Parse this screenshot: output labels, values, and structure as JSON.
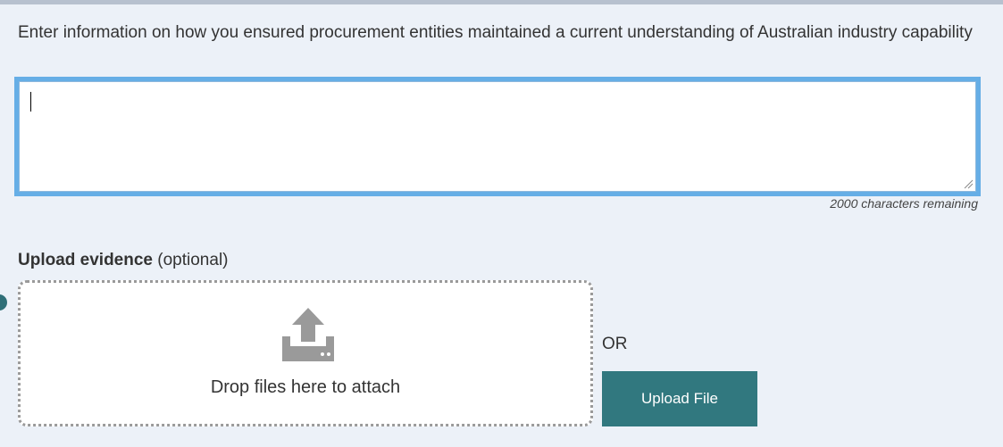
{
  "form": {
    "prompt": "Enter information on how you ensured procurement entities maintained a current understanding of Australian industry capability",
    "textarea_value": "",
    "chars_remaining": "2000 characters remaining"
  },
  "upload": {
    "label_strong": "Upload evidence",
    "label_optional": "(optional)",
    "drop_text": "Drop files here to attach",
    "drop_icon": "upload-tray-icon",
    "or_text": "OR",
    "button_label": "Upload File"
  },
  "colors": {
    "page_background": "#ecf1f8",
    "focus_border": "#66aee6",
    "button_background": "#31787f",
    "button_text": "#ffffff"
  }
}
